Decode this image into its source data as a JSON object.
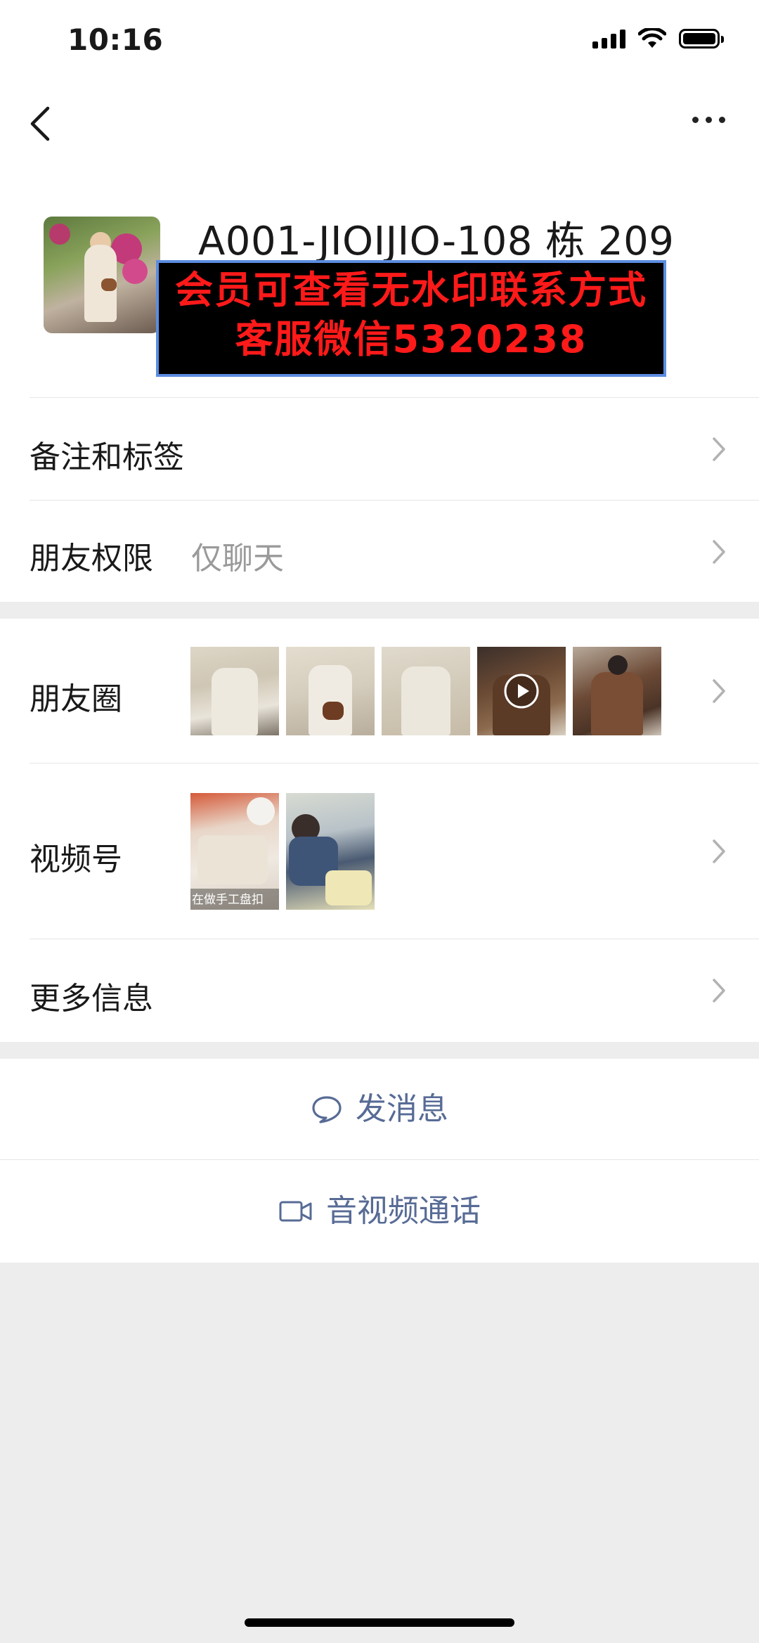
{
  "status_bar": {
    "time": "10:16"
  },
  "profile": {
    "display_name": "A001-JIOIJIO-108 栋 209",
    "watermark_line1": "会员可查看无水印联系方式",
    "watermark_line2": "客服微信5320238"
  },
  "rows": {
    "remark": {
      "label": "备注和标签"
    },
    "permission": {
      "label": "朋友权限",
      "value": "仅聊天"
    },
    "moments": {
      "label": "朋友圈"
    },
    "channels": {
      "label": "视频号",
      "thumb_caption": "在做手工盘扣"
    },
    "more_info": {
      "label": "更多信息"
    }
  },
  "actions": {
    "message": "发消息",
    "call": "音视频通话"
  },
  "colors": {
    "link_blue": "#576b95",
    "watermark_red": "#ff1a1a",
    "background_gray": "#ededed"
  },
  "icons": [
    "back-icon",
    "more-icon",
    "chevron-right-icon",
    "chat-bubble-icon",
    "video-camera-icon",
    "play-icon",
    "wifi-icon",
    "signal-icon",
    "battery-icon"
  ]
}
